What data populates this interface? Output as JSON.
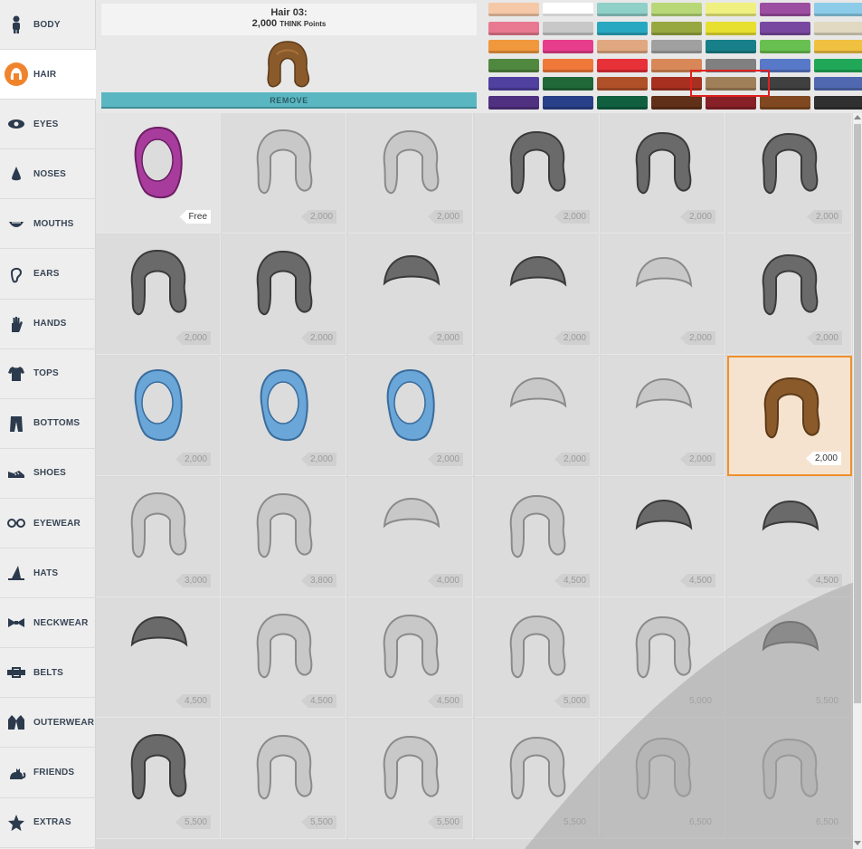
{
  "sidebar": {
    "items": [
      {
        "label": "BODY",
        "icon": "body-icon"
      },
      {
        "label": "HAIR",
        "icon": "hair-icon",
        "active": true
      },
      {
        "label": "EYES",
        "icon": "eye-icon"
      },
      {
        "label": "NOSES",
        "icon": "nose-icon"
      },
      {
        "label": "MOUTHS",
        "icon": "mouth-icon"
      },
      {
        "label": "EARS",
        "icon": "ear-icon"
      },
      {
        "label": "HANDS",
        "icon": "hand-icon"
      },
      {
        "label": "TOPS",
        "icon": "shirt-icon"
      },
      {
        "label": "BOTTOMS",
        "icon": "pants-icon"
      },
      {
        "label": "SHOES",
        "icon": "shoe-icon"
      },
      {
        "label": "EYEWEAR",
        "icon": "glasses-icon"
      },
      {
        "label": "HATS",
        "icon": "hat-icon"
      },
      {
        "label": "NECKWEAR",
        "icon": "bowtie-icon"
      },
      {
        "label": "BELTS",
        "icon": "belt-icon"
      },
      {
        "label": "OUTERWEAR",
        "icon": "jacket-icon"
      },
      {
        "label": "FRIENDS",
        "icon": "cat-icon"
      },
      {
        "label": "EXTRAS",
        "icon": "star-icon"
      }
    ]
  },
  "selected_item": {
    "title": "Hair 03:",
    "price": "2,000",
    "currency": "THINK Points"
  },
  "remove_label": "REMOVE",
  "swatches": [
    [
      "#f5c8a8",
      "#ffffff",
      "#8fd0c8",
      "#b8d878",
      "#f0f080",
      "#9c4ea0",
      "#8ccce8"
    ],
    [
      "#e87890",
      "#c8c8c8",
      "#28a8c0",
      "#98a840",
      "#e8e030",
      "#7848a0",
      "#e0d8c0"
    ],
    [
      "#f0983c",
      "#e83c8c",
      "#e0a880",
      "#a0a0a0",
      "#188088",
      "#68c050",
      "#f0c040"
    ],
    [
      "#508840",
      "#f07838",
      "#e83038",
      "#d88858",
      "#808080",
      "#5878c8",
      "#20a858"
    ],
    [
      "#5040a0",
      "#206838",
      "#b05028",
      "#a83020",
      "#a08058",
      "#404040",
      "#5068b0"
    ],
    [
      "#503080",
      "#284088",
      "#106040",
      "#603018",
      "#882028",
      "#804820",
      "#303030"
    ]
  ],
  "items": [
    {
      "price": "Free",
      "style": "hijab-purple",
      "highlight": true
    },
    {
      "price": "2,000",
      "style": "bob"
    },
    {
      "price": "2,000",
      "style": "fluffy-pigtails"
    },
    {
      "price": "2,000",
      "style": "afro-short"
    },
    {
      "price": "2,000",
      "style": "puffs"
    },
    {
      "price": "2,000",
      "style": "curly-long"
    },
    {
      "price": "2,000",
      "style": "afro-wide"
    },
    {
      "price": "2,000",
      "style": "curly-headband"
    },
    {
      "price": "2,000",
      "style": "smooth-cap"
    },
    {
      "price": "2,000",
      "style": "wavy-top"
    },
    {
      "price": "2,000",
      "style": "side-swoop"
    },
    {
      "price": "2,000",
      "style": "big-afro"
    },
    {
      "price": "2,000",
      "style": "hijab-dotted"
    },
    {
      "price": "2,000",
      "style": "hijab-blue"
    },
    {
      "price": "2,000",
      "style": "hijab-light"
    },
    {
      "price": "2,000",
      "style": "spiky"
    },
    {
      "price": "2,000",
      "style": "tuft"
    },
    {
      "price": "2,000",
      "style": "hair-03-brown",
      "selected": true
    },
    {
      "price": "3,000",
      "style": "shag"
    },
    {
      "price": "3,800",
      "style": "pigtails"
    },
    {
      "price": "4,000",
      "style": "flip"
    },
    {
      "price": "4,500",
      "style": "braids"
    },
    {
      "price": "4,500",
      "style": "buzz"
    },
    {
      "price": "4,500",
      "style": "fade"
    },
    {
      "price": "4,500",
      "style": "flat-top"
    },
    {
      "price": "4,500",
      "style": "curly-band"
    },
    {
      "price": "4,500",
      "style": "emo"
    },
    {
      "price": "5,000",
      "style": "long-straight"
    },
    {
      "price": "5,000",
      "style": "wavy-short"
    },
    {
      "price": "5,500",
      "style": "spiky-crown"
    },
    {
      "price": "5,500",
      "style": "locs"
    },
    {
      "price": "5,500",
      "style": "bun-sides"
    },
    {
      "price": "5,500",
      "style": "swept"
    },
    {
      "price": "5,500",
      "style": "bangs-long"
    },
    {
      "price": "6,500",
      "style": "top-bun"
    },
    {
      "price": "6,500",
      "style": "curly-top"
    }
  ]
}
